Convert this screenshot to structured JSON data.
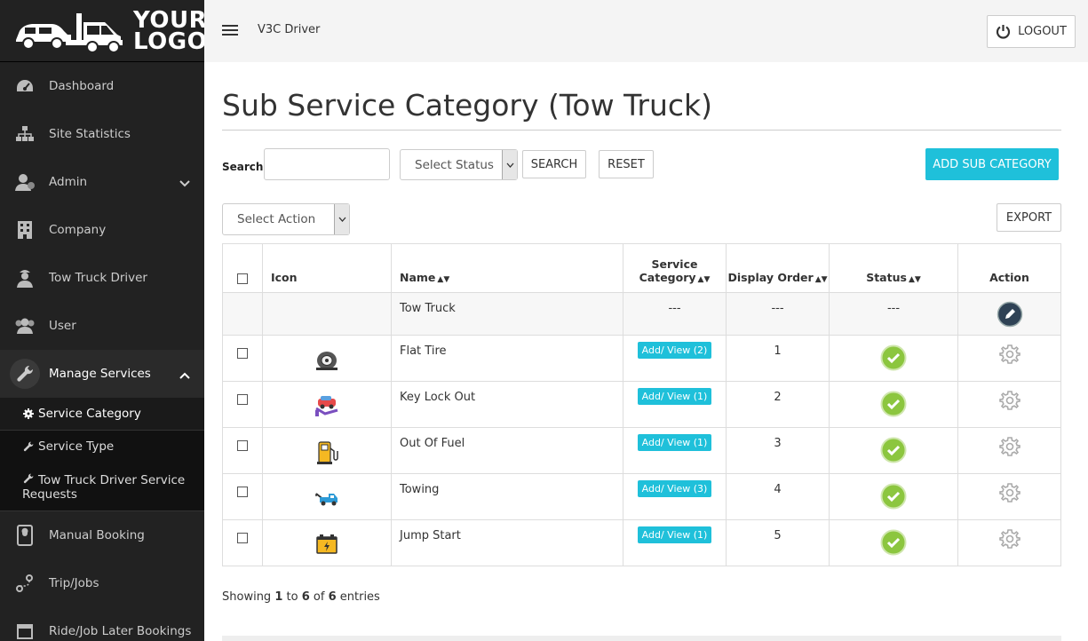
{
  "logo": {
    "line1": "YOUR",
    "line2": "LOGO"
  },
  "sidebar": {
    "items": [
      {
        "label": "Dashboard",
        "icon": "dashboard-icon"
      },
      {
        "label": "Site Statistics",
        "icon": "sitemap-icon"
      },
      {
        "label": "Admin",
        "icon": "admin-icon",
        "expandable": true
      },
      {
        "label": "Company",
        "icon": "building-icon"
      },
      {
        "label": "Tow Truck Driver",
        "icon": "driver-icon"
      },
      {
        "label": "User",
        "icon": "users-icon"
      },
      {
        "label": "Manage Services",
        "icon": "wrench-icon",
        "expanded": true
      }
    ],
    "sub_items": [
      {
        "label": "Service Category",
        "icon": "gear-icon"
      },
      {
        "label": "Service Type",
        "icon": "wrench-icon"
      },
      {
        "label": "Tow Truck Driver Service Requests",
        "icon": "wrench-icon"
      }
    ],
    "items_after": [
      {
        "label": "Manual Booking",
        "icon": "booking-icon"
      },
      {
        "label": "Trip/Jobs",
        "icon": "route-icon"
      },
      {
        "label": "Ride/Job Later Bookings",
        "icon": "calendar-icon"
      }
    ]
  },
  "topbar": {
    "site_name": "V3C Driver",
    "logout_label": "LOGOUT"
  },
  "page": {
    "title": "Sub Service Category (Tow Truck)"
  },
  "filters": {
    "search_label": "Search:",
    "search_value": "",
    "status_select": "Select Status",
    "search_button": "SEARCH",
    "reset_button": "RESET",
    "add_button": "ADD SUB CATEGORY",
    "action_select": "Select Action",
    "export_button": "EXPORT"
  },
  "table": {
    "headers": {
      "icon": "Icon",
      "name": "Name",
      "category_line1": "Service",
      "category_line2": "Category",
      "order": "Display Order",
      "status": "Status",
      "action": "Action"
    },
    "parent": {
      "name": "Tow Truck",
      "category": "---",
      "order": "---",
      "status": "---"
    },
    "rows": [
      {
        "name": "Flat Tire",
        "category": "Add/ View (2)",
        "order": "1",
        "icon": "flat-tire-icon"
      },
      {
        "name": "Key Lock Out",
        "category": "Add/ View (1)",
        "order": "2",
        "icon": "key-lock-icon"
      },
      {
        "name": "Out Of Fuel",
        "category": "Add/ View (1)",
        "order": "3",
        "icon": "fuel-icon"
      },
      {
        "name": "Towing",
        "category": "Add/ View (3)",
        "order": "4",
        "icon": "tow-truck-icon"
      },
      {
        "name": "Jump Start",
        "category": "Add/ View (1)",
        "order": "5",
        "icon": "battery-icon"
      }
    ]
  },
  "footer": {
    "prefix": "Showing",
    "from": "1",
    "to_word": "to",
    "to": "6",
    "of_word": "of",
    "total": "6",
    "suffix": "entries"
  },
  "colors": {
    "accent": "#1fc0da",
    "sidebar_bg": "#222222",
    "status_ok": "#8cc63f"
  }
}
